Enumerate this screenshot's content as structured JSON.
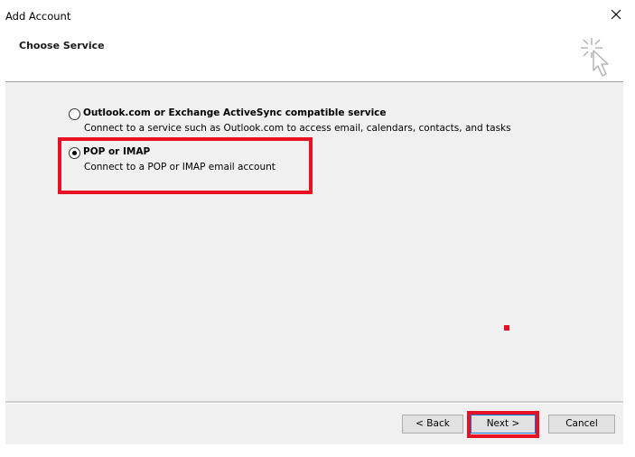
{
  "window": {
    "title": "Add Account",
    "close_icon": "close-icon"
  },
  "header": {
    "subtitle": "Choose Service",
    "icon": "cursor-sparkle-icon"
  },
  "options": [
    {
      "label": "Outlook.com or Exchange ActiveSync compatible service",
      "description": "Connect to a service such as Outlook.com to access email, calendars, contacts, and tasks",
      "selected": false
    },
    {
      "label": "POP or IMAP",
      "description": "Connect to a POP or IMAP email account",
      "selected": true
    }
  ],
  "footer": {
    "back_label": "< Back",
    "next_label": "Next >",
    "cancel_label": "Cancel"
  },
  "annotations": {
    "highlight_color": "#e81123"
  }
}
